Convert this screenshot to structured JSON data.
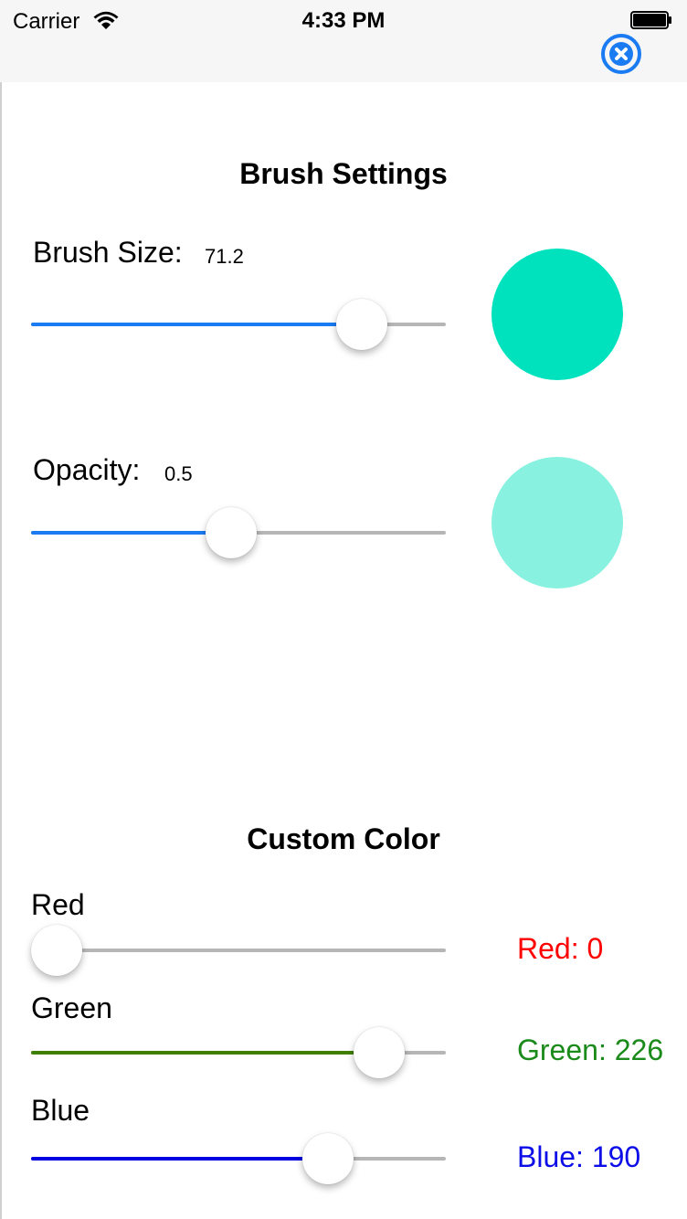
{
  "status_bar": {
    "carrier": "Carrier",
    "time": "4:33 PM",
    "icons": [
      "wifi-icon",
      "battery-icon"
    ]
  },
  "toolbar": {
    "close_icon": "close-circle-icon",
    "accent": "#1a7bf2"
  },
  "brush_settings": {
    "title": "Brush Settings",
    "brush_size": {
      "label": "Brush Size:",
      "value": "71.2",
      "slider_fraction": 0.84,
      "fill_color": "#1a7bf2"
    },
    "opacity": {
      "label": "Opacity:",
      "value": "0.5",
      "slider_fraction": 0.48,
      "fill_color": "#1a7bf2"
    },
    "preview_colors": {
      "brush": "#00e2be",
      "opacity": "#88f1df"
    }
  },
  "custom_color": {
    "title": "Custom Color",
    "red": {
      "label": "Red",
      "readout": "Red: 0",
      "slider_fraction": 0.0,
      "color": "#ff0000",
      "fill_color": "#ff0000"
    },
    "green": {
      "label": "Green",
      "readout": "Green: 226",
      "slider_fraction": 0.8863,
      "color": "#1a8a1a",
      "fill_color": "#3f7f00"
    },
    "blue": {
      "label": "Blue",
      "readout": "Blue: 190",
      "slider_fraction": 0.745,
      "color": "#0d0de8",
      "fill_color": "#0000e0"
    }
  }
}
